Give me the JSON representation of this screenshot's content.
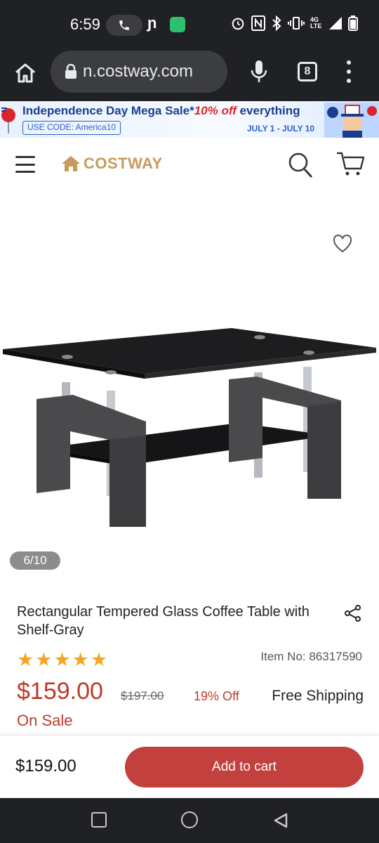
{
  "status_bar": {
    "time": "6:59",
    "network_label": "4G LTE",
    "icons": [
      "phone-icon",
      "app-n-icon",
      "app-green-icon",
      "alarm-icon",
      "nfc-icon",
      "bluetooth-icon",
      "vibrate-icon",
      "signal-icon",
      "battery-icon"
    ]
  },
  "browser": {
    "url": "n.costway.com",
    "tab_count": "8",
    "icons": [
      "home-icon",
      "lock-icon",
      "microphone-icon",
      "tabs-icon",
      "more-vert-icon"
    ]
  },
  "promo": {
    "title_prefix": "Independence Day Mega Sale*",
    "title_highlight": "10% off",
    "title_suffix": " everything",
    "code_label": "USE CODE:  America10",
    "dates": "JULY 1 - JULY 10",
    "colors": {
      "primary": "#1a3d8f",
      "highlight": "#d9262c"
    }
  },
  "header": {
    "logo_text": "COSTWAY",
    "brand_color": "#c89b5a",
    "icons": [
      "menu-icon",
      "logo-house-icon",
      "search-icon",
      "cart-icon"
    ]
  },
  "gallery": {
    "counter": "6/10",
    "image_subject": "black glass coffee table with gray wood legs",
    "icons": [
      "heart-icon"
    ]
  },
  "product": {
    "title": "Rectangular Tempered Glass Coffee Table with Shelf-Gray",
    "rating_stars": 5,
    "item_no": "Item No: 86317590",
    "price": "$159.00",
    "old_price": "$197.00",
    "discount": "19% Off",
    "shipping": "Free Shipping",
    "sale_label": "On Sale",
    "accent_color": "#c0392b",
    "icons": [
      "share-icon",
      "star-icon"
    ]
  },
  "cart_bar": {
    "price": "$159.00",
    "button_label": "Add to cart",
    "button_color": "#c2403d"
  },
  "nav_bar": {
    "icons": [
      "recents-icon",
      "home-circle-icon",
      "back-icon"
    ]
  }
}
